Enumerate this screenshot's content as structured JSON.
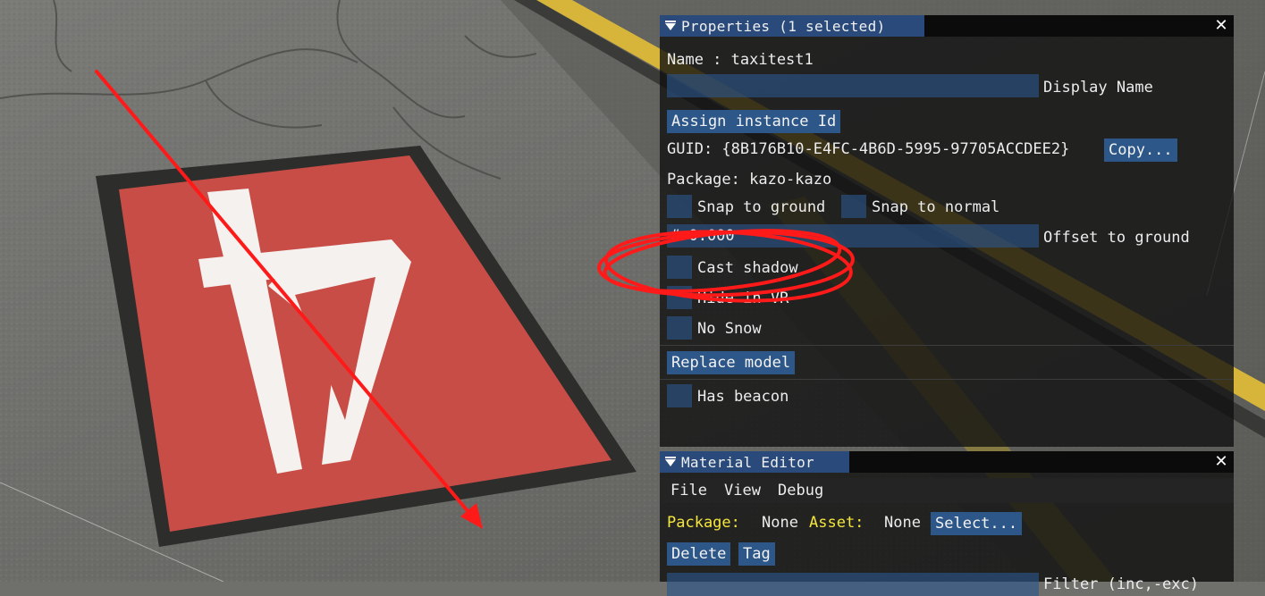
{
  "properties": {
    "title": "Properties (1 selected)",
    "name_line": "Name : taxitest1",
    "display_name_label": "Display Name",
    "assign_btn": "Assign instance Id",
    "guid_line": "GUID: {8B176B10-E4FC-4B6D-5995-97705ACCDEE2}",
    "copy_btn": "Copy...",
    "package_line": "Package: kazo-kazo",
    "snap_ground": "Snap to ground",
    "snap_normal": "Snap to normal",
    "offset_value": "# 0.000",
    "offset_label": "Offset to ground",
    "cast_shadow": "Cast shadow",
    "hide_label": "Hide in VR",
    "no_snow": "No Snow",
    "replace_btn": "Replace model",
    "has_beacon": "Has beacon"
  },
  "material_editor": {
    "title": "Material Editor",
    "menu": [
      "File",
      "View",
      "Debug"
    ],
    "package_label": "Package:",
    "package_value": "None",
    "asset_label": "Asset:",
    "asset_value": "None",
    "select_btn": "Select...",
    "delete_btn": "Delete",
    "tag_btn": "Tag",
    "filter_label": "Filter (inc,-exc)"
  },
  "colors": {
    "panel_title_active": "#294a7a",
    "button": "#2d5789",
    "annotation": "#ff1a1a",
    "label_yellow": "#f5e63c",
    "sign_red": "#c94d47"
  },
  "icons": [
    "collapse-triangle-icon",
    "close-icon"
  ]
}
